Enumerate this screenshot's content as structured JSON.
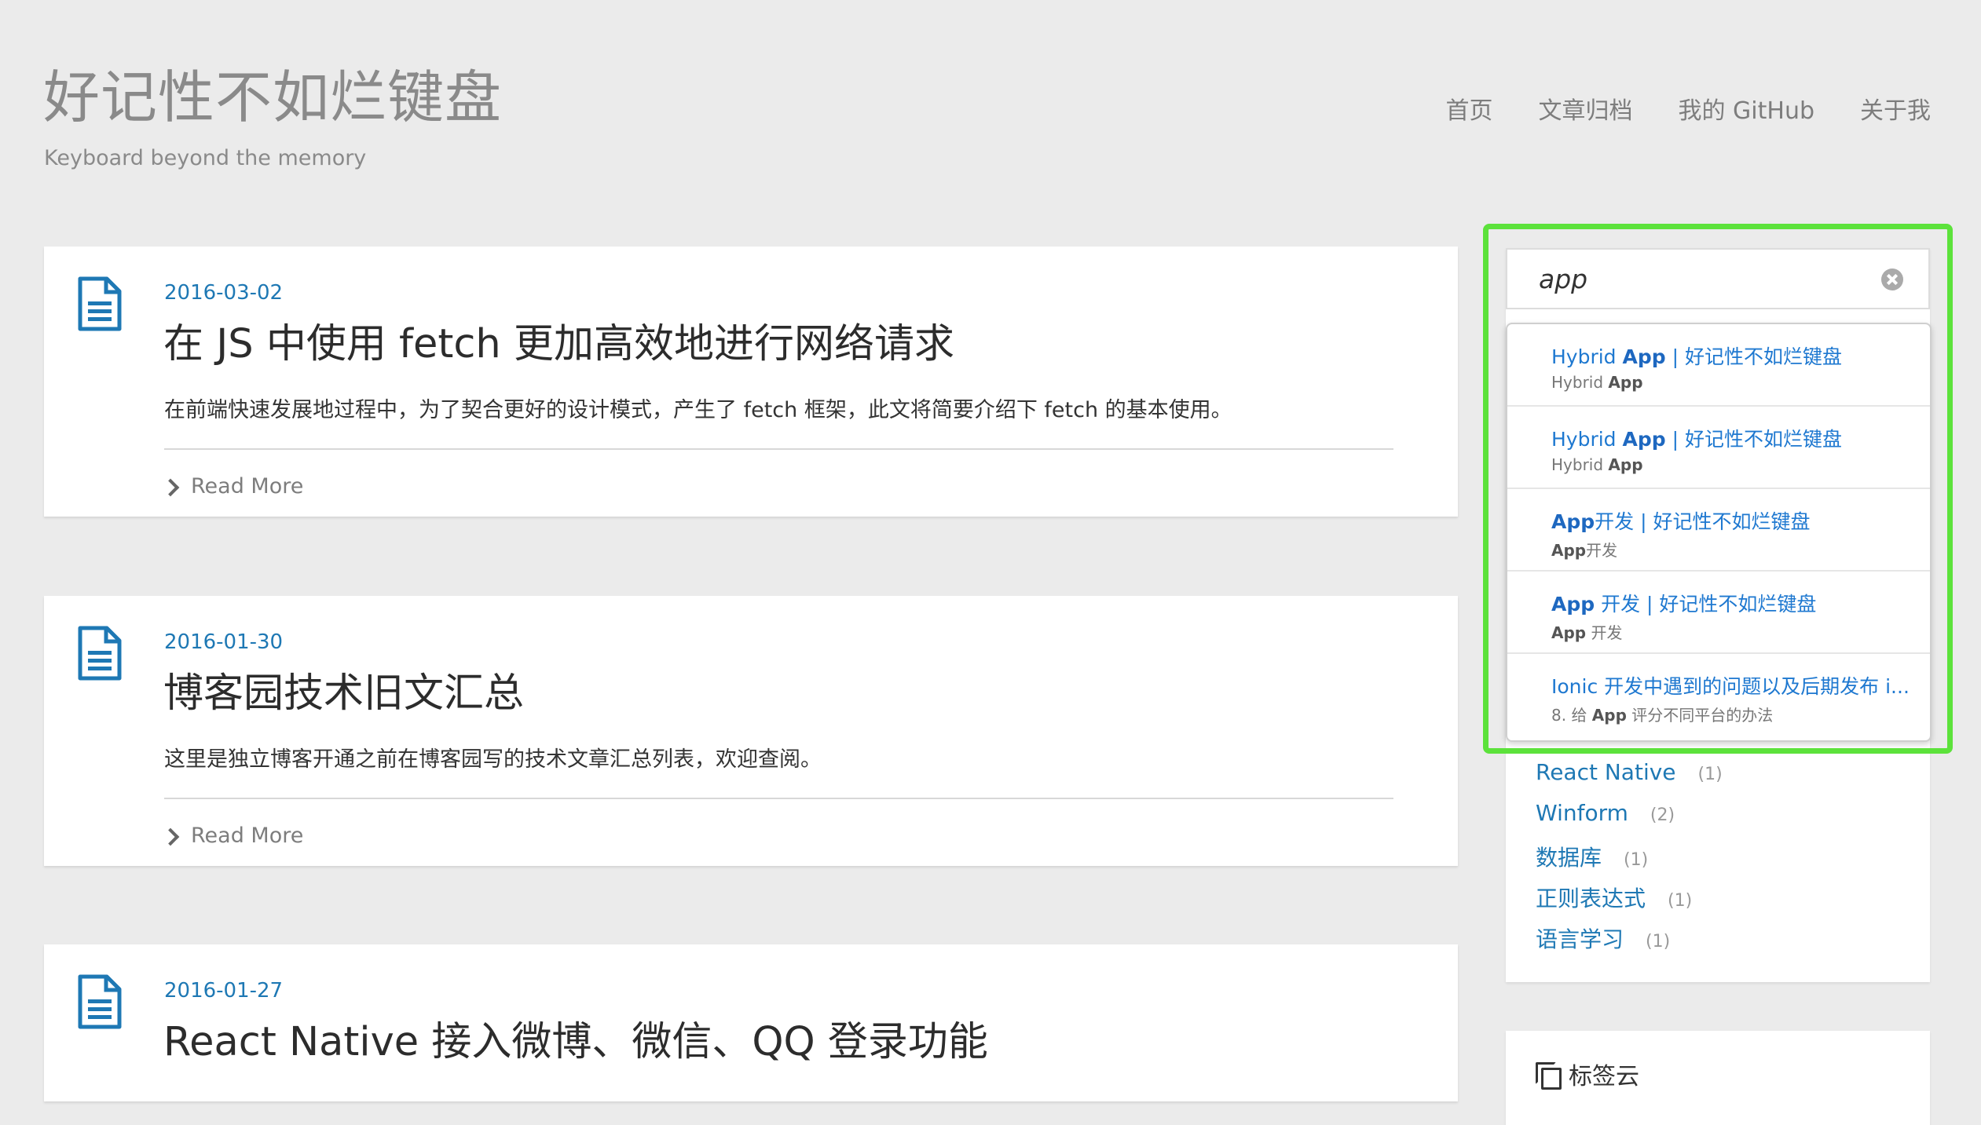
{
  "header": {
    "site_title": "好记性不如烂键盘",
    "subtitle": "Keyboard beyond the memory",
    "nav": [
      "首页",
      "文章归档",
      "我的 GitHub",
      "关于我"
    ]
  },
  "posts": [
    {
      "date": "2016-03-02",
      "title": "在 JS 中使用 fetch 更加高效地进行网络请求",
      "excerpt": "在前端快速发展地过程中，为了契合更好的设计模式，产生了 fetch 框架，此文将简要介绍下 fetch 的基本使用。",
      "read_more": "Read More"
    },
    {
      "date": "2016-01-30",
      "title": "博客园技术旧文汇总",
      "excerpt": "这里是独立博客开通之前在博客园写的技术文章汇总列表，欢迎查阅。",
      "read_more": "Read More"
    },
    {
      "date": "2016-01-27",
      "title": "React Native 接入微博、微信、QQ 登录功能"
    }
  ],
  "search": {
    "query": "app",
    "suggestions": [
      {
        "title_prefix": "Hybrid ",
        "title_match": "App",
        "title_suffix": " | 好记性不如烂键盘",
        "sub_prefix": "Hybrid ",
        "sub_match": "App",
        "sub_suffix": ""
      },
      {
        "title_prefix": "Hybrid ",
        "title_match": "App",
        "title_suffix": " | 好记性不如烂键盘",
        "sub_prefix": "Hybrid ",
        "sub_match": "App",
        "sub_suffix": ""
      },
      {
        "title_prefix": "",
        "title_match": "App",
        "title_suffix": "开发 | 好记性不如烂键盘",
        "sub_prefix": "",
        "sub_match": "App",
        "sub_suffix": "开发"
      },
      {
        "title_prefix": "",
        "title_match": "App",
        "title_suffix": " 开发 | 好记性不如烂键盘",
        "sub_prefix": "",
        "sub_match": "App",
        "sub_suffix": " 开发"
      },
      {
        "title_prefix": "Ionic 开发中遇到的问题以及后期发布 i...",
        "title_match": "",
        "title_suffix": "",
        "sub_prefix": "8. 给 ",
        "sub_match": "App",
        "sub_suffix": " 评分不同平台的办法"
      }
    ]
  },
  "tags": [
    {
      "name": "React Native",
      "count": "(1)"
    },
    {
      "name": "Winform",
      "count": "(2)"
    },
    {
      "name": "数据库",
      "count": "(1)"
    },
    {
      "name": "正则表达式",
      "count": "(1)"
    },
    {
      "name": "语言学习",
      "count": "(1)"
    }
  ],
  "tagcloud": {
    "title": "标签云"
  },
  "colors": {
    "link": "#1e78b4",
    "highlight": "#5ce23b",
    "background": "#ebebeb"
  }
}
